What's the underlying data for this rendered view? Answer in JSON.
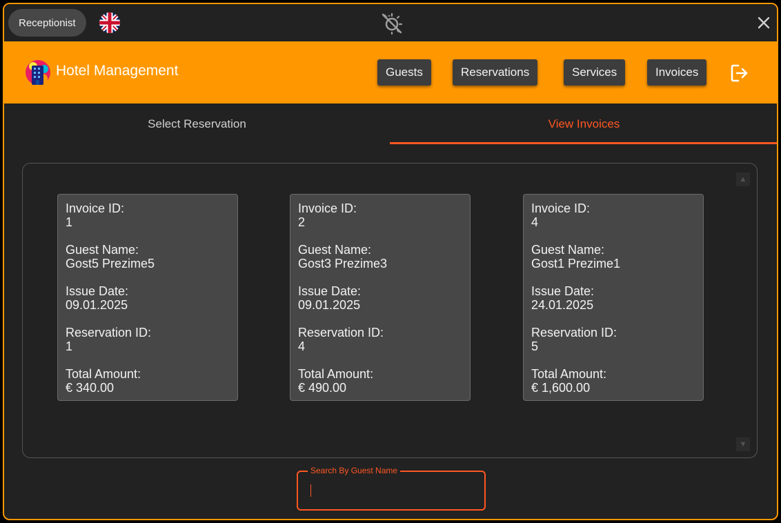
{
  "titlebar": {
    "role": "Receptionist",
    "language_icon": "uk-flag-icon",
    "theme_icon": "theme-toggle-icon",
    "close_icon": "close-icon"
  },
  "header": {
    "app_title": "Hotel Management",
    "nav": [
      {
        "label": "Guests"
      },
      {
        "label": "Reservations"
      },
      {
        "label": "Services"
      },
      {
        "label": "Invoices"
      }
    ],
    "logout_icon": "logout-icon"
  },
  "tabs": [
    {
      "label": "Select Reservation",
      "active": false
    },
    {
      "label": "View Invoices",
      "active": true
    }
  ],
  "invoice_labels": {
    "invoice_id": "Invoice ID:",
    "guest_name": "Guest Name:",
    "issue_date": "Issue Date:",
    "reservation_id": "Reservation ID:",
    "total_amount": "Total Amount:"
  },
  "invoices": [
    {
      "invoice_id": "1",
      "guest_name": "Gost5 Prezime5",
      "issue_date": "09.01.2025",
      "reservation_id": "1",
      "total_amount": "€ 340.00"
    },
    {
      "invoice_id": "2",
      "guest_name": "Gost3 Prezime3",
      "issue_date": "09.01.2025",
      "reservation_id": "4",
      "total_amount": "€ 490.00"
    },
    {
      "invoice_id": "4",
      "guest_name": "Gost1 Prezime1",
      "issue_date": "24.01.2025",
      "reservation_id": "5",
      "total_amount": "€ 1,600.00"
    }
  ],
  "search": {
    "label": "Search By Guest Name",
    "value": ""
  },
  "colors": {
    "accent_orange": "#ff9800",
    "highlight": "#ff5722",
    "background": "#222222",
    "card": "#474747"
  }
}
